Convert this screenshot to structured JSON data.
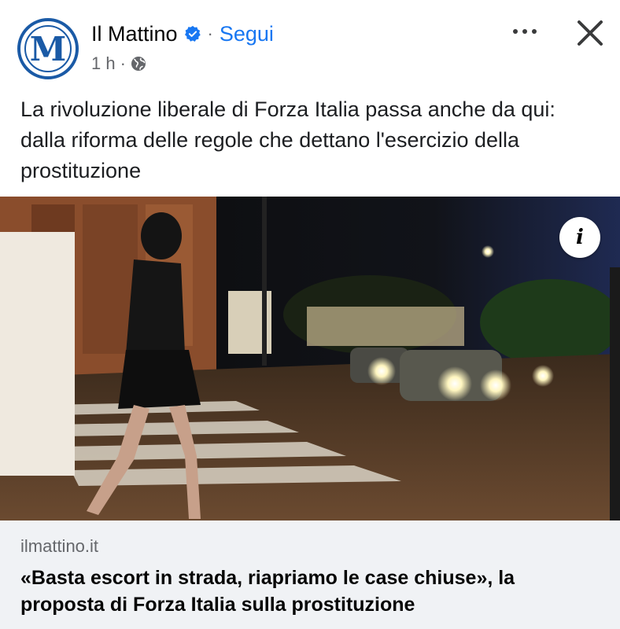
{
  "post": {
    "page_name": "Il Mattino",
    "avatar_letter": "M",
    "dot": "·",
    "follow_label": "Segui",
    "time": "1 h",
    "meta_sep": "·",
    "caption": "La rivoluzione liberale di Forza Italia passa anche da qui: dalla riforma delle regole che dettano l'esercizio della prostituzione",
    "info_icon_text": "i"
  },
  "link_preview": {
    "domain": "ilmattino.it",
    "title": "«Basta escort in strada, riapriamo le case chiuse», la proposta di Forza Italia sulla prostituzione"
  },
  "icons": {
    "verified": "verified-badge-icon",
    "privacy": "globe-icon",
    "more": "more-options-icon",
    "close": "close-icon",
    "info": "info-icon"
  },
  "colors": {
    "accent": "#1877f2",
    "brand": "#1a5aa6",
    "secondary_text": "#65676b",
    "link_bg": "#f0f2f5"
  }
}
